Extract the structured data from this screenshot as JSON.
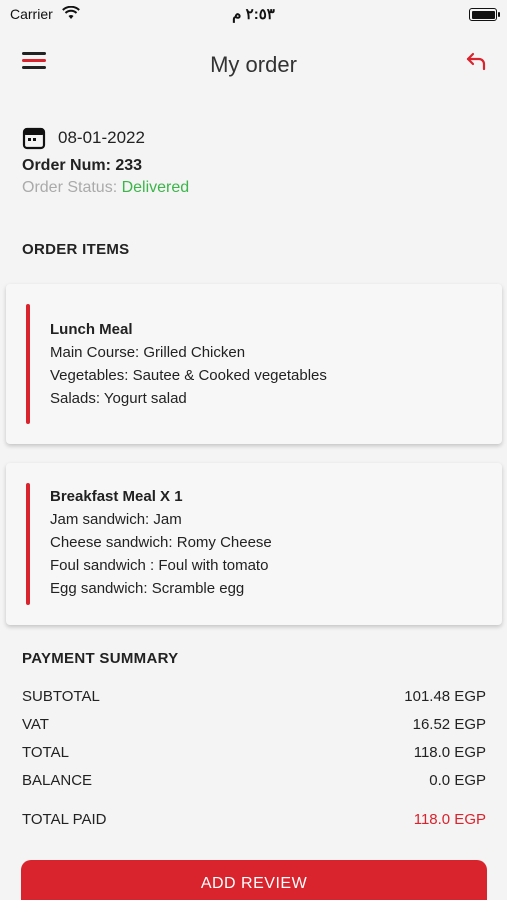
{
  "status_bar": {
    "carrier": "Carrier",
    "time": "٢:٥٣ م"
  },
  "header": {
    "title": "My order"
  },
  "order": {
    "date": "08-01-2022",
    "number_label": "Order Num: 233",
    "status_label": "Order Status: ",
    "status_value": "Delivered"
  },
  "order_items": {
    "title": "ORDER ITEMS",
    "items": [
      {
        "name": "Lunch Meal",
        "lines": [
          "Main Course: Grilled Chicken",
          "Vegetables: Sautee & Cooked vegetables",
          "Salads: Yogurt salad"
        ]
      },
      {
        "name": "Breakfast Meal X 1",
        "lines": [
          "Jam sandwich: Jam",
          "Cheese sandwich: Romy Cheese",
          "Foul sandwich : Foul with tomato",
          "Egg sandwich: Scramble egg"
        ]
      }
    ]
  },
  "payment": {
    "title": "PAYMENT SUMMARY",
    "rows": [
      {
        "label": "SUBTOTAL",
        "value": "101.48 EGP"
      },
      {
        "label": "VAT",
        "value": "16.52 EGP"
      },
      {
        "label": "TOTAL",
        "value": "118.0 EGP"
      },
      {
        "label": "BALANCE",
        "value": "0.0 EGP"
      }
    ],
    "total_paid": {
      "label": "TOTAL PAID",
      "value": "118.0 EGP"
    }
  },
  "actions": {
    "review_label": "ADD REVIEW"
  },
  "colors": {
    "accent": "#d9232d",
    "delivered": "#3cb54a"
  }
}
